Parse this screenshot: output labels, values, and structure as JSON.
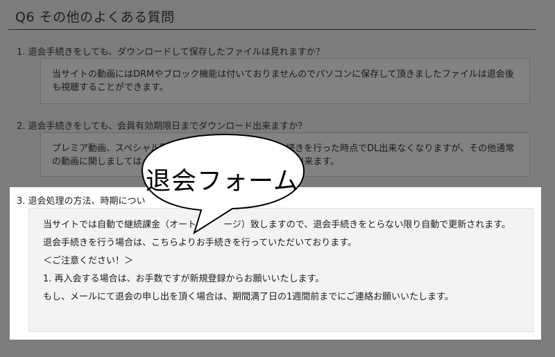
{
  "section": {
    "title": "Q6 その他のよくある質問"
  },
  "faq": [
    {
      "question": "1. 退会手続きをしても、ダウンロードして保存したファイルは見れますか？",
      "answer": [
        "当サイトの動画にはDRMやブロック機能は付いておりませんのでパソコンに保存して頂きましたファイルは退会後も視聴することができます。"
      ]
    },
    {
      "question": "2. 退会手続きをしても、会員有効期限日までダウンロード出来ますか？",
      "answer": [
        "プレミア動画、スペシャル動　　　　　　　　　　　　　続きを行った時点でDL出来なくなりますが、その他通常の動画に関しましては　　　　　　　　　　　　　ることが出来ます。"
      ]
    },
    {
      "question": "3. 退会処理の方法、時期につい",
      "answer": [
        "当サイトでは自動で継続課金（オート　　　ージ）致しますので、退会手続きをとらない限り自動で更新されます。",
        "退会手続きを行う場合は、こちらよりお手続きを行っていただいております。",
        "＜ご注意ください！＞",
        "1. 再入会する場合は、お手数ですが新規登録からお願いいたします。",
        "もし、メールにて退会の申し出を頂く場合は、期間満了日の1週間前までにご連絡お願いいたします。"
      ]
    }
  ],
  "callout": {
    "text": "退会フォーム"
  }
}
